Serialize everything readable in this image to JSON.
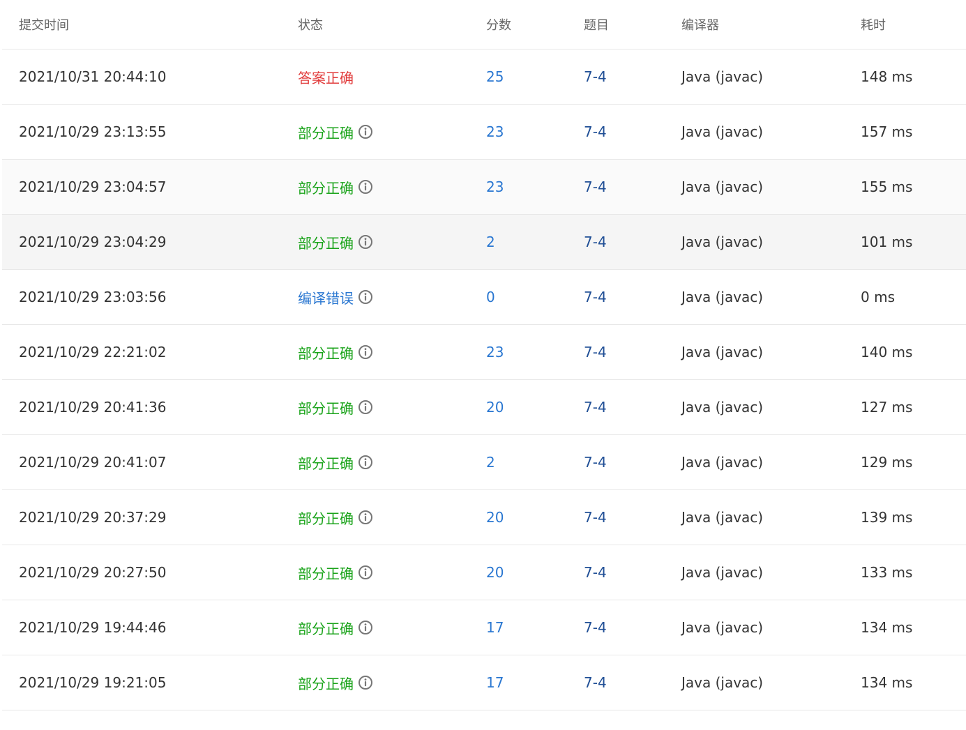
{
  "headers": {
    "time": "提交时间",
    "status": "状态",
    "score": "分数",
    "problem": "题目",
    "compiler": "编译器",
    "duration": "耗时"
  },
  "colors": {
    "accepted": "#e13b3b",
    "partial": "#1aa31a",
    "compile_error": "#2a77d1",
    "link": "#2a77d1",
    "problem_link": "#1f4e95"
  },
  "rows": [
    {
      "time": "2021/10/31 20:44:10",
      "status": "答案正确",
      "status_type": "accepted",
      "score": "25",
      "problem": "7-4",
      "compiler": "Java (javac)",
      "duration": "148 ms"
    },
    {
      "time": "2021/10/29 23:13:55",
      "status": "部分正确",
      "status_type": "partial",
      "score": "23",
      "problem": "7-4",
      "compiler": "Java (javac)",
      "duration": "157 ms"
    },
    {
      "time": "2021/10/29 23:04:57",
      "status": "部分正确",
      "status_type": "partial",
      "score": "23",
      "problem": "7-4",
      "compiler": "Java (javac)",
      "duration": "155 ms"
    },
    {
      "time": "2021/10/29 23:04:29",
      "status": "部分正确",
      "status_type": "partial",
      "score": "2",
      "problem": "7-4",
      "compiler": "Java (javac)",
      "duration": "101 ms"
    },
    {
      "time": "2021/10/29 23:03:56",
      "status": "编译错误",
      "status_type": "compile_error",
      "score": "0",
      "problem": "7-4",
      "compiler": "Java (javac)",
      "duration": "0 ms"
    },
    {
      "time": "2021/10/29 22:21:02",
      "status": "部分正确",
      "status_type": "partial",
      "score": "23",
      "problem": "7-4",
      "compiler": "Java (javac)",
      "duration": "140 ms"
    },
    {
      "time": "2021/10/29 20:41:36",
      "status": "部分正确",
      "status_type": "partial",
      "score": "20",
      "problem": "7-4",
      "compiler": "Java (javac)",
      "duration": "127 ms"
    },
    {
      "time": "2021/10/29 20:41:07",
      "status": "部分正确",
      "status_type": "partial",
      "score": "2",
      "problem": "7-4",
      "compiler": "Java (javac)",
      "duration": "129 ms"
    },
    {
      "time": "2021/10/29 20:37:29",
      "status": "部分正确",
      "status_type": "partial",
      "score": "20",
      "problem": "7-4",
      "compiler": "Java (javac)",
      "duration": "139 ms"
    },
    {
      "time": "2021/10/29 20:27:50",
      "status": "部分正确",
      "status_type": "partial",
      "score": "20",
      "problem": "7-4",
      "compiler": "Java (javac)",
      "duration": "133 ms"
    },
    {
      "time": "2021/10/29 19:44:46",
      "status": "部分正确",
      "status_type": "partial",
      "score": "17",
      "problem": "7-4",
      "compiler": "Java (javac)",
      "duration": "134 ms"
    },
    {
      "time": "2021/10/29 19:21:05",
      "status": "部分正确",
      "status_type": "partial",
      "score": "17",
      "problem": "7-4",
      "compiler": "Java (javac)",
      "duration": "134 ms"
    }
  ]
}
